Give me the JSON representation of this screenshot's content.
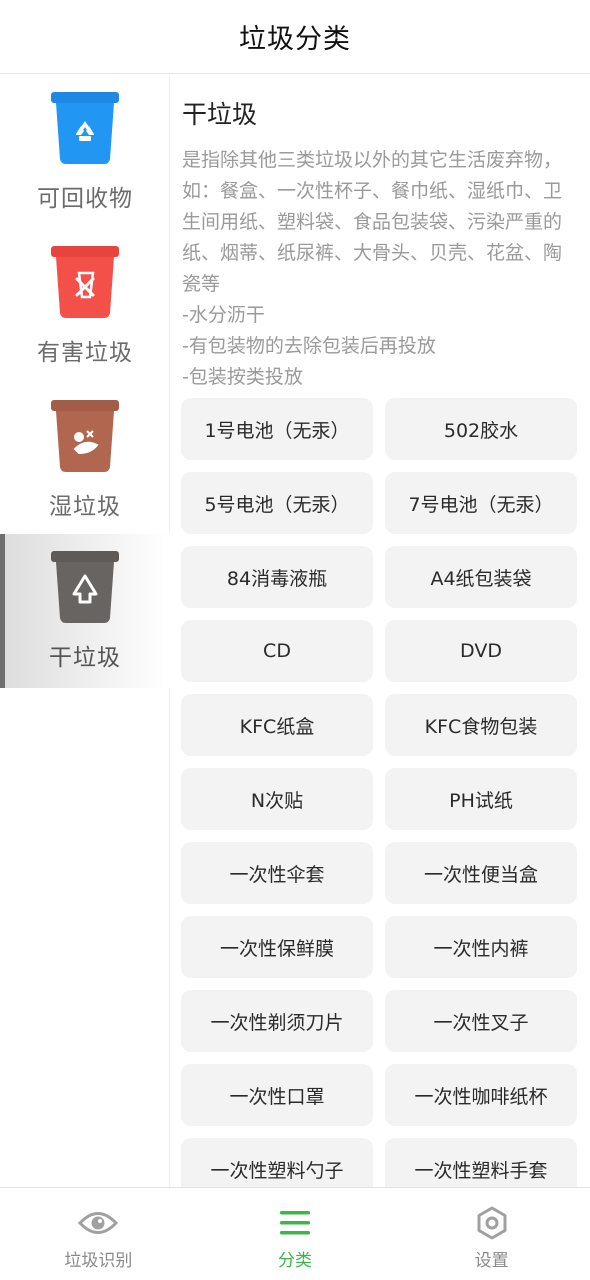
{
  "header": {
    "title": "垃圾分类"
  },
  "sidebar": {
    "items": [
      {
        "label": "可回收物",
        "color": "#2196F3",
        "icon": "recycle-icon"
      },
      {
        "label": "有害垃圾",
        "color": "#F4504A",
        "icon": "hazard-icon"
      },
      {
        "label": "湿垃圾",
        "color": "#B0664F",
        "icon": "food-waste-icon"
      },
      {
        "label": "干垃圾",
        "color": "#676461",
        "icon": "dry-waste-icon",
        "selected": true
      }
    ]
  },
  "content": {
    "title": "干垃圾",
    "description": [
      "是指除其他三类垃圾以外的其它生活废弃物，如：餐盒、一次性杯子、餐巾纸、湿纸巾、卫生间用纸、塑料袋、食品包装袋、污染严重的纸、烟蒂、纸尿裤、大骨头、贝壳、花盆、陶瓷等",
      "-水分沥干",
      "-有包装物的去除包装后再投放",
      "-包装按类投放"
    ],
    "items": [
      "1号电池（无汞）",
      "502胶水",
      "5号电池（无汞）",
      "7号电池（无汞）",
      "84消毒液瓶",
      "A4纸包装袋",
      "CD",
      "DVD",
      "KFC纸盒",
      "KFC食物包装",
      "N次贴",
      "PH试纸",
      "一次性伞套",
      "一次性便当盒",
      "一次性保鲜膜",
      "一次性内裤",
      "一次性剃须刀片",
      "一次性叉子",
      "一次性口罩",
      "一次性咖啡纸杯",
      "一次性塑料勺子",
      "一次性塑料手套"
    ]
  },
  "tabbar": {
    "tabs": [
      {
        "label": "垃圾识别",
        "icon": "eye-icon"
      },
      {
        "label": "分类",
        "icon": "menu-icon",
        "active": true
      },
      {
        "label": "设置",
        "icon": "settings-icon"
      }
    ],
    "active_color": "#3cb54a",
    "inactive_color": "#9a9a9a"
  }
}
